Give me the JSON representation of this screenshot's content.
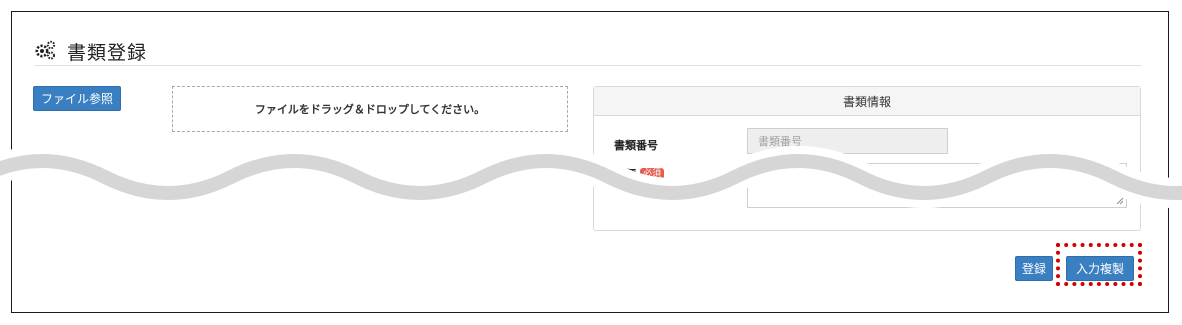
{
  "header": {
    "title": "書類登録",
    "icon": "gears-icon"
  },
  "upload": {
    "browse_label": "ファイル参照",
    "dropzone_text": "ファイルをドラッグ＆ドロップしてください。"
  },
  "info_panel": {
    "heading": "書類情報",
    "number_label": "書類番号",
    "number_placeholder": "書類番号",
    "type_label_fragment": "種類",
    "required_badge": "必須",
    "type_value": ""
  },
  "actions": {
    "register_label": "登録",
    "copy_label": "入力複製"
  },
  "colors": {
    "primary": "#3a7fc1",
    "required_badge": "#e35d4f",
    "highlight": "#d40000",
    "wave": "#d6d6d6"
  }
}
